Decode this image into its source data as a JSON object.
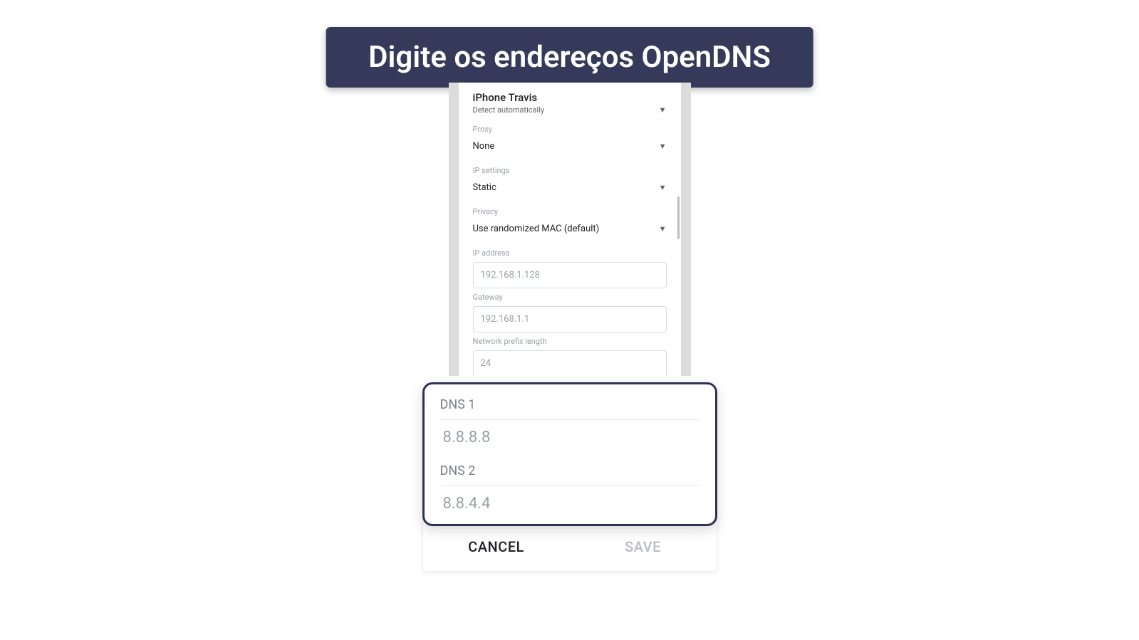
{
  "banner": {
    "title": "Digite os endereços OpenDNS"
  },
  "network": {
    "ssid": "iPhone Travis",
    "detect_mode": "Detect automatically"
  },
  "fields": {
    "proxy": {
      "label": "Proxy",
      "value": "None"
    },
    "ip_settings": {
      "label": "IP settings",
      "value": "Static"
    },
    "privacy": {
      "label": "Privacy",
      "value": "Use randomized MAC (default)"
    },
    "ip_address": {
      "label": "IP address",
      "placeholder": "192.168.1.128"
    },
    "gateway": {
      "label": "Gateway",
      "placeholder": "192.168.1.1"
    },
    "prefix_length": {
      "label": "Network prefix length",
      "placeholder": "24"
    }
  },
  "dns": {
    "dns1": {
      "label": "DNS 1",
      "placeholder": "8.8.8.8"
    },
    "dns2": {
      "label": "DNS 2",
      "placeholder": "8.8.4.4"
    }
  },
  "buttons": {
    "cancel": "CANCEL",
    "save": "SAVE"
  }
}
